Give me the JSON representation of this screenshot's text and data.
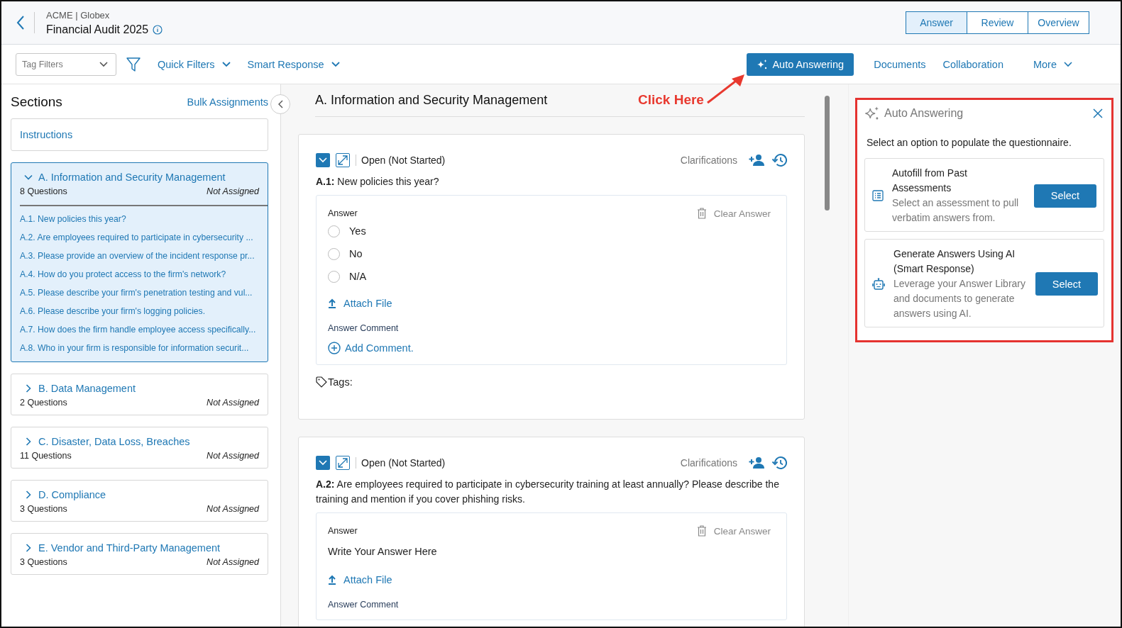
{
  "header": {
    "breadcrumb": "ACME | Globex",
    "title": "Financial Audit 2025"
  },
  "mode_tabs": [
    {
      "label": "Answer",
      "selected": true
    },
    {
      "label": "Review",
      "selected": false
    },
    {
      "label": "Overview",
      "selected": false
    }
  ],
  "toolbar": {
    "tag_filter": {
      "placeholder": "Tag Filters"
    },
    "dropdowns": [
      "Quick Filters",
      "Smart Response"
    ],
    "primary_button": "Auto Answering",
    "links": [
      "Documents",
      "Collaboration"
    ],
    "more": "More"
  },
  "sidebar": {
    "title": "Sections",
    "action": "Bulk Assignments",
    "instructions": "Instructions",
    "sections": [
      {
        "title": "A. Information and Security Management",
        "count": "8 Questions",
        "assignee": "Not Assigned",
        "expanded": true,
        "selected": true,
        "children": [
          {
            "label": "A.1. New policies this year?"
          },
          {
            "label": "A.2. Are employees required to participate in cybersecurity ..."
          },
          {
            "label": "A.3. Please provide an overview of the incident response pr..."
          },
          {
            "label": "A.4. How do you protect access to the firm's network?"
          },
          {
            "label": "A.5. Please describe your firm's penetration testing and vul..."
          },
          {
            "label": "A.6. Please describe your firm's logging policies."
          },
          {
            "label": "A.7. How does the firm handle employee access specifically..."
          },
          {
            "label": "A.8. Who in your firm is responsible for information securit..."
          }
        ]
      },
      {
        "title": "B. Data Management",
        "count": "2 Questions",
        "assignee": "Not Assigned",
        "expanded": false,
        "selected": false
      },
      {
        "title": "C. Disaster, Data Loss, Breaches",
        "count": "11 Questions",
        "assignee": "Not Assigned",
        "expanded": false,
        "selected": false
      },
      {
        "title": "D. Compliance",
        "count": "3 Questions",
        "assignee": "Not Assigned",
        "expanded": false,
        "selected": false
      },
      {
        "title": "E. Vendor and Third-Party Management",
        "count": "3 Questions",
        "assignee": "Not Assigned",
        "expanded": false,
        "selected": false
      }
    ]
  },
  "main": {
    "heading": "A. Information and Security Management",
    "annotation": "Click Here",
    "questions": [
      {
        "kind": "radio",
        "status": "Open (Not Started)",
        "clarifications": "Clarifications",
        "number": "A.1:",
        "text": "New policies this year?",
        "answer_label": "Answer",
        "clear": "Clear Answer",
        "options": [
          {
            "label": "Yes",
            "selected": false
          },
          {
            "label": "No",
            "selected": false
          },
          {
            "label": "N/A",
            "selected": false
          }
        ],
        "attach": "Attach File",
        "comment_label": "Answer Comment",
        "add_comment": "Add Comment.",
        "tags": "Tags:"
      },
      {
        "kind": "text",
        "status": "Open (Not Started)",
        "clarifications": "Clarifications",
        "number": "A.2:",
        "text": "Are employees required to participate in cybersecurity training at least annually? Please describe the training and mention if you cover phishing risks.",
        "answer_label": "Answer",
        "clear": "Clear Answer",
        "placeholder": "Write Your Answer Here",
        "attach": "Attach File",
        "comment_label": "Answer Comment"
      }
    ]
  },
  "auto_panel": {
    "title": "Auto Answering",
    "intro": "Select an option to populate the questionnaire.",
    "options": [
      {
        "kind": "list",
        "title": "Autofill from Past Assessments",
        "description": "Select an assessment to pull verbatim answers from.",
        "button": "Select"
      },
      {
        "kind": "robot",
        "title": "Generate Answers Using AI (Smart Response)",
        "description": "Leverage your Answer Library and documents to generate answers using AI.",
        "button": "Select"
      }
    ]
  }
}
